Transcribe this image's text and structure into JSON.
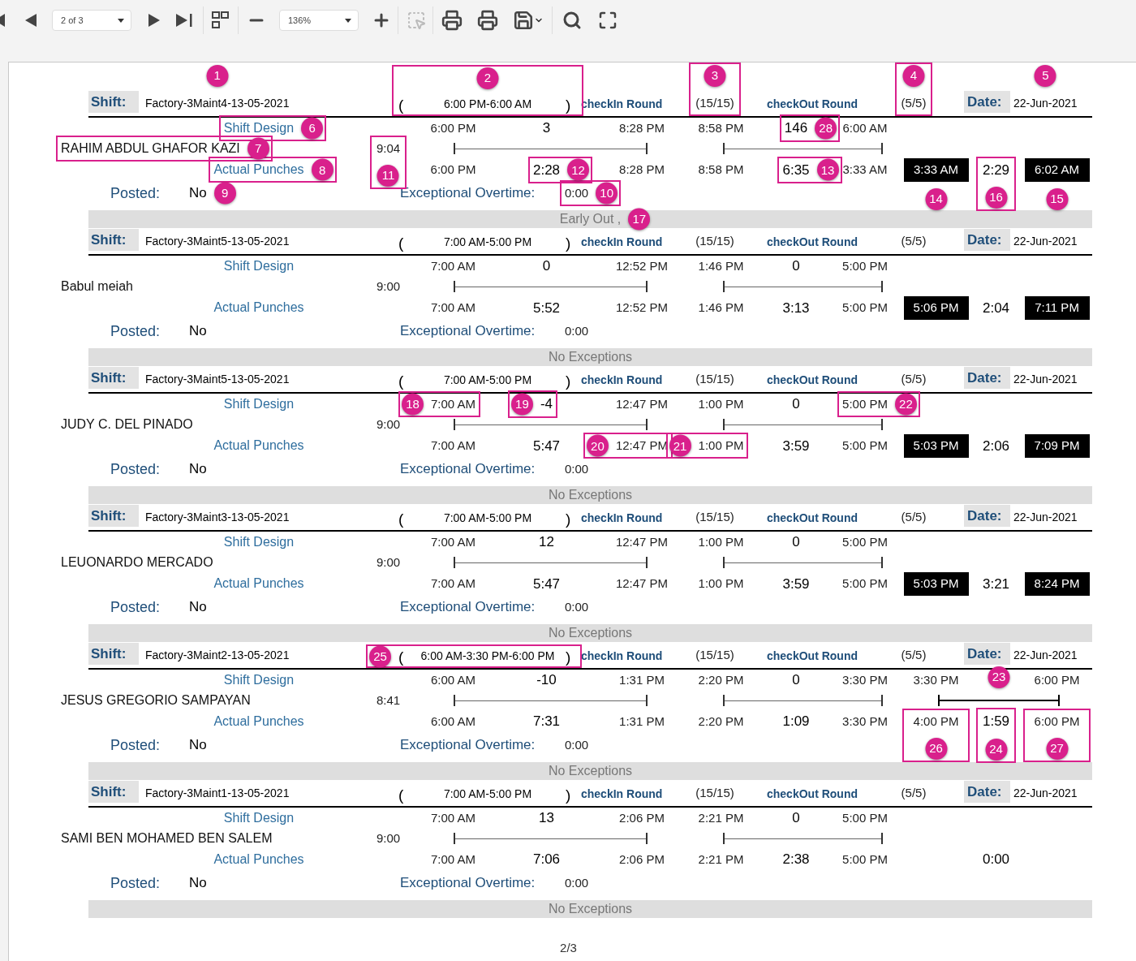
{
  "toolbar": {
    "page_select": "2 of 3",
    "zoom_select": "136%"
  },
  "records": [
    {
      "header": {
        "shift_label": "Shift:",
        "name": {
          "text": "Factory-3Maint4-13-05-2021",
          "callout": {
            "number": "1",
            "kind": "above",
            "boxed": false
          }
        },
        "open": "(",
        "time": {
          "text": "6:00 PM-6:00 AM",
          "callout": {
            "number": "2",
            "kind": "above",
            "boxed": true
          }
        },
        "close": ")",
        "checkin_label": "checkIn Round",
        "checkin": {
          "text": "(15/15)",
          "callout": {
            "number": "3",
            "kind": "above",
            "boxed": true
          }
        },
        "checkout_label": "checkOut Round",
        "checkout": {
          "text": "(5/5)",
          "callout": {
            "number": "4",
            "kind": "above",
            "boxed": true
          }
        },
        "date_label": "Date:",
        "date": {
          "text": "22-Jun-2021",
          "callout": {
            "number": "5",
            "kind": "above",
            "boxed": false
          }
        }
      },
      "design_label": {
        "text": "Shift Design",
        "callout": {
          "number": "6",
          "kind": "right",
          "boxed": true
        }
      },
      "design": {
        "start": "6:00 PM",
        "late": "3",
        "break_start": "8:28 PM",
        "break_end": "8:58 PM",
        "break_diff": {
          "text": "146",
          "callout": {
            "number": "28",
            "kind": "right",
            "boxed": true
          }
        },
        "end": "6:00 AM"
      },
      "employee": {
        "text": "RAHIM ABDUL GHAFOR KAZI",
        "callout": {
          "number": "7",
          "kind": "right",
          "boxed": true
        }
      },
      "total": {
        "text": "9:04",
        "callout": {
          "number": "11",
          "kind": "below",
          "boxed": true
        }
      },
      "overtime_line": false,
      "actual_label": {
        "text": "Actual Punches",
        "callout": {
          "number": "8",
          "kind": "right",
          "boxed": true
        }
      },
      "actual": {
        "in": "6:00 PM",
        "work1": {
          "text": "2:28",
          "callout": {
            "number": "12",
            "kind": "right",
            "boxed": true
          }
        },
        "break_out": "8:28 PM",
        "break_in": "8:58 PM",
        "work2": {
          "text": "6:35",
          "callout": {
            "number": "13",
            "kind": "right",
            "boxed": true
          }
        },
        "out": "3:33 AM",
        "ot_in": {
          "text": "3:33 AM",
          "highlighted": true,
          "callout": {
            "number": "14",
            "kind": "below",
            "boxed": false
          }
        },
        "ot_hours": {
          "text": "2:29",
          "callout": {
            "number": "16",
            "kind": "below",
            "boxed": true
          }
        },
        "ot_out": {
          "text": "6:02 AM",
          "highlighted": true,
          "callout": {
            "number": "15",
            "kind": "below",
            "boxed": false
          }
        }
      },
      "posted_label": "Posted:",
      "posted": {
        "text": "No",
        "callout": {
          "number": "9",
          "kind": "right",
          "boxed": false
        }
      },
      "overtime_label": "Exceptional Overtime:",
      "overtime": {
        "text": "0:00",
        "callout": {
          "number": "10",
          "kind": "right",
          "boxed": true
        }
      },
      "exceptions": {
        "text": "Early Out ,",
        "callout": {
          "number": "17",
          "kind": "right",
          "boxed": false
        }
      }
    },
    {
      "header": {
        "shift_label": "Shift:",
        "name": "Factory-3Maint5-13-05-2021",
        "open": "(",
        "time": "7:00 AM-5:00 PM",
        "close": ")",
        "checkin_label": "checkIn Round",
        "checkin": "(15/15)",
        "checkout_label": "checkOut Round",
        "checkout": "(5/5)",
        "date_label": "Date:",
        "date": "22-Jun-2021"
      },
      "design_label": "Shift Design",
      "design": {
        "start": "7:00 AM",
        "late": "0",
        "break_start": "12:52 PM",
        "break_end": "1:46 PM",
        "break_diff": "0",
        "end": "5:00 PM"
      },
      "employee": "Babul meiah",
      "total": "9:00",
      "overtime_line": false,
      "actual_label": "Actual Punches",
      "actual": {
        "in": "7:00 AM",
        "work1": "5:52",
        "break_out": "12:52 PM",
        "break_in": "1:46 PM",
        "work2": "3:13",
        "out": "5:00 PM",
        "ot_in": {
          "text": "5:06 PM",
          "highlighted": true
        },
        "ot_hours": "2:04",
        "ot_out": {
          "text": "7:11 PM",
          "highlighted": true
        }
      },
      "posted_label": "Posted:",
      "posted": "No",
      "overtime_label": "Exceptional Overtime:",
      "overtime": "0:00",
      "exceptions": "No Exceptions"
    },
    {
      "header": {
        "shift_label": "Shift:",
        "name": "Factory-3Maint5-13-05-2021",
        "open": "(",
        "time": "7:00 AM-5:00 PM",
        "close": ")",
        "checkin_label": "checkIn Round",
        "checkin": "(15/15)",
        "checkout_label": "checkOut Round",
        "checkout": "(5/5)",
        "date_label": "Date:",
        "date": "22-Jun-2021"
      },
      "design_label": "Shift Design",
      "design": {
        "start": {
          "text": "7:00 AM",
          "callout": {
            "number": "18",
            "kind": "left",
            "boxed": true
          }
        },
        "late": {
          "text": "-4",
          "callout": {
            "number": "19",
            "kind": "left",
            "boxed": true
          }
        },
        "break_start": "12:47 PM",
        "break_end": "1:00 PM",
        "break_diff": "0",
        "end": {
          "text": "5:00 PM",
          "callout": {
            "number": "22",
            "kind": "right",
            "boxed": true
          }
        }
      },
      "employee": "JUDY C. DEL PINADO",
      "total": "9:00",
      "overtime_line": false,
      "actual_label": "Actual Punches",
      "actual": {
        "in": "7:00 AM",
        "work1": "5:47",
        "break_out": {
          "text": "12:47 PM",
          "callout": {
            "number": "20",
            "kind": "left",
            "boxed": true
          }
        },
        "break_in": {
          "text": "1:00 PM",
          "callout": {
            "number": "21",
            "kind": "left",
            "boxed": true
          }
        },
        "work2": "3:59",
        "out": "5:00 PM",
        "ot_in": {
          "text": "5:03 PM",
          "highlighted": true
        },
        "ot_hours": "2:06",
        "ot_out": {
          "text": "7:09 PM",
          "highlighted": true
        }
      },
      "posted_label": "Posted:",
      "posted": "No",
      "overtime_label": "Exceptional Overtime:",
      "overtime": "0:00",
      "exceptions": "No Exceptions"
    },
    {
      "header": {
        "shift_label": "Shift:",
        "name": "Factory-3Maint3-13-05-2021",
        "open": "(",
        "time": "7:00 AM-5:00 PM",
        "close": ")",
        "checkin_label": "checkIn Round",
        "checkin": "(15/15)",
        "checkout_label": "checkOut Round",
        "checkout": "(5/5)",
        "date_label": "Date:",
        "date": "22-Jun-2021"
      },
      "design_label": "Shift Design",
      "design": {
        "start": "7:00 AM",
        "late": "12",
        "break_start": "12:47 PM",
        "break_end": "1:00 PM",
        "break_diff": "0",
        "end": "5:00 PM"
      },
      "employee": "LEUONARDO MERCADO",
      "total": "9:00",
      "overtime_line": false,
      "actual_label": "Actual Punches",
      "actual": {
        "in": "7:00 AM",
        "work1": "5:47",
        "break_out": "12:47 PM",
        "break_in": "1:00 PM",
        "work2": "3:59",
        "out": "5:00 PM",
        "ot_in": {
          "text": "5:03 PM",
          "highlighted": true
        },
        "ot_hours": "3:21",
        "ot_out": {
          "text": "8:24 PM",
          "highlighted": true
        }
      },
      "posted_label": "Posted:",
      "posted": "No",
      "overtime_label": "Exceptional Overtime:",
      "overtime": "0:00",
      "exceptions": "No Exceptions"
    },
    {
      "header": {
        "shift_label": "Shift:",
        "name": "Factory-3Maint2-13-05-2021",
        "open": "(",
        "time": {
          "text": "6:00 AM-3:30 PM-6:00 PM",
          "callout": {
            "number": "25",
            "kind": "left",
            "boxed": true
          }
        },
        "close": ")",
        "checkin_label": "checkIn Round",
        "checkin": "(15/15)",
        "checkout_label": "checkOut Round",
        "checkout": "(5/5)",
        "date_label": "Date:",
        "date": "22-Jun-2021"
      },
      "design_label": "Shift Design",
      "design": {
        "start": "6:00 AM",
        "late": "-10",
        "break_start": "1:31 PM",
        "break_end": "2:20 PM",
        "break_diff": "0",
        "end": "3:30 PM",
        "ot_start": "3:30 PM",
        "ot_end": "6:00 PM"
      },
      "employee": "JESUS GREGORIO SAMPAYAN",
      "total": "8:41",
      "overtime_line": true,
      "overtime_line_callout": {
        "number": "23",
        "kind": "above",
        "boxed": false
      },
      "actual_label": "Actual Punches",
      "actual": {
        "in": "6:00 AM",
        "work1": "7:31",
        "break_out": "1:31 PM",
        "break_in": "2:20 PM",
        "work2": "1:09",
        "out": "3:30 PM",
        "ot_in": {
          "text": "4:00 PM",
          "highlighted": false,
          "callout": {
            "number": "26",
            "kind": "below",
            "boxed": true
          }
        },
        "ot_hours": {
          "text": "1:59",
          "callout": {
            "number": "24",
            "kind": "below",
            "boxed": true
          }
        },
        "ot_out": {
          "text": "6:00 PM",
          "highlighted": false,
          "callout": {
            "number": "27",
            "kind": "below",
            "boxed": true
          }
        }
      },
      "posted_label": "Posted:",
      "posted": "No",
      "overtime_label": "Exceptional Overtime:",
      "overtime": "0:00",
      "exceptions": "No Exceptions"
    },
    {
      "header": {
        "shift_label": "Shift:",
        "name": "Factory-3Maint1-13-05-2021",
        "open": "(",
        "time": "7:00 AM-5:00 PM",
        "close": ")",
        "checkin_label": "checkIn Round",
        "checkin": "(15/15)",
        "checkout_label": "checkOut Round",
        "checkout": "(5/5)",
        "date_label": "Date:",
        "date": "22-Jun-2021"
      },
      "design_label": "Shift Design",
      "design": {
        "start": "7:00 AM",
        "late": "13",
        "break_start": "2:06 PM",
        "break_end": "2:21 PM",
        "break_diff": "0",
        "end": "5:00 PM"
      },
      "employee": "SAMI BEN MOHAMED BEN SALEM",
      "total": "9:00",
      "overtime_line": false,
      "actual_label": "Actual Punches",
      "actual": {
        "in": "7:00 AM",
        "work1": "7:06",
        "break_out": "2:06 PM",
        "break_in": "2:21 PM",
        "work2": "2:38",
        "out": "5:00 PM",
        "ot_hours": "0:00"
      },
      "posted_label": "Posted:",
      "posted": "No",
      "overtime_label": "Exceptional Overtime:",
      "overtime": "0:00",
      "exceptions": "No Exceptions"
    }
  ],
  "page_number": "2/3"
}
